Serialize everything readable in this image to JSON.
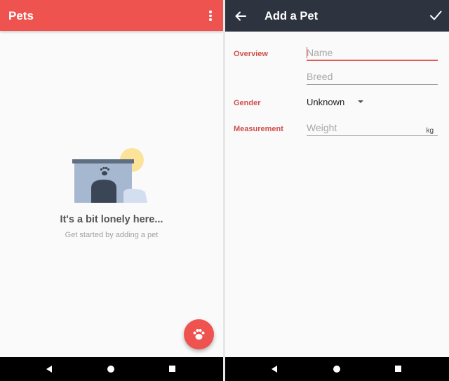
{
  "pets_screen": {
    "title": "Pets",
    "overflow_icon": "more-vert-icon",
    "empty_title": "It's a bit lonely here...",
    "empty_subtitle": "Get started by adding a pet",
    "fab_icon": "paw-icon",
    "colors": {
      "primary": "#ef5350",
      "background": "#fafafa"
    }
  },
  "add_pet_screen": {
    "title": "Add a Pet",
    "back_icon": "arrow-back-icon",
    "save_icon": "check-icon",
    "overview_label": "Overview",
    "name_placeholder": "Name",
    "breed_placeholder": "Breed",
    "gender_label": "Gender",
    "gender_value": "Unknown",
    "measurement_label": "Measurement",
    "weight_placeholder": "Weight",
    "weight_unit": "kg",
    "colors": {
      "toolbar": "#2e3340",
      "label": "#d0504c",
      "focus": "#e05a56"
    }
  },
  "system_nav": {
    "back_icon": "nav-back-icon",
    "home_icon": "nav-home-icon",
    "recents_icon": "nav-recents-icon"
  }
}
